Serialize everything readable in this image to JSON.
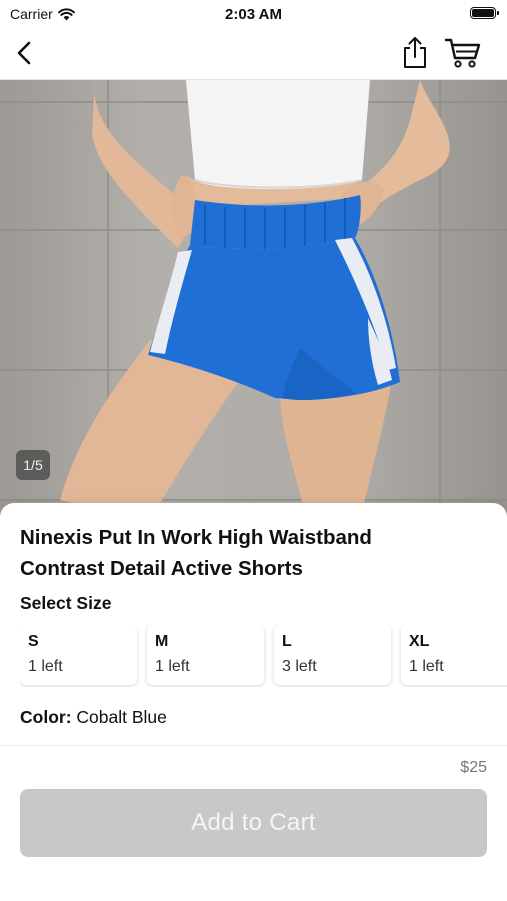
{
  "status_bar": {
    "carrier": "Carrier",
    "time": "2:03 AM"
  },
  "nav_bar": {
    "icons": [
      "chevron-left-icon",
      "share-icon",
      "cart-icon"
    ]
  },
  "gallery": {
    "counter": "1/5",
    "product_color": "#1f6fd6",
    "wall_color": "#a8a5a0"
  },
  "product": {
    "title_line1": "Ninexis Put In Work High Waistband",
    "title_line2": "Contrast Detail Active Shorts",
    "select_size_label": "Select Size",
    "sizes": [
      {
        "code": "S",
        "stock": "1 left"
      },
      {
        "code": "M",
        "stock": "1 left"
      },
      {
        "code": "L",
        "stock": "3 left"
      },
      {
        "code": "XL",
        "stock": "1 left"
      }
    ],
    "color_label": "Color:",
    "color_value": "Cobalt Blue"
  },
  "purchase": {
    "price": "$25",
    "add_to_cart_label": "Add to Cart",
    "button_color": "#c8c8c8"
  }
}
